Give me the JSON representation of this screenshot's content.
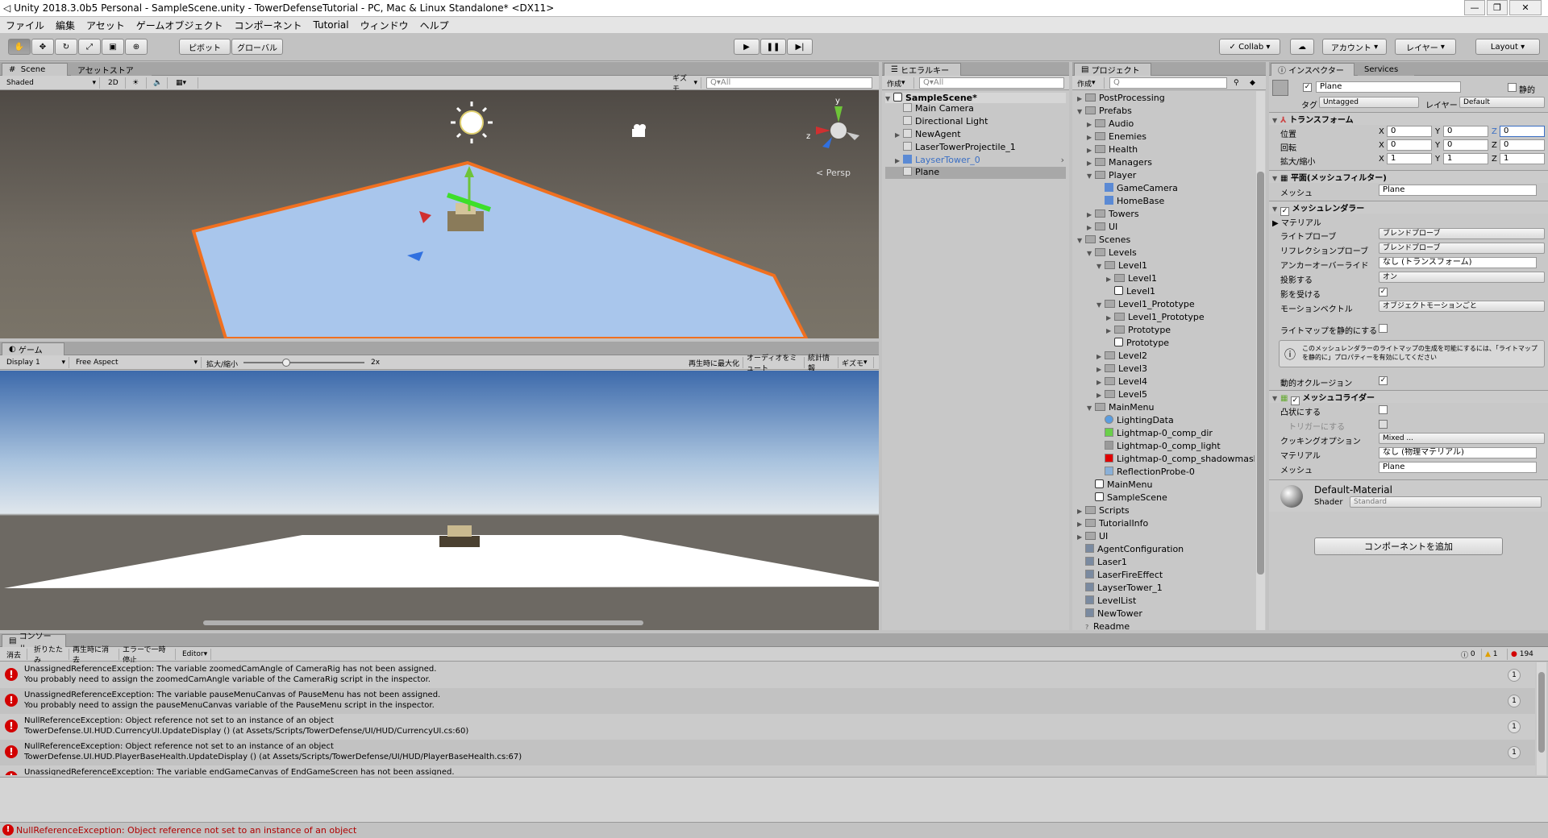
{
  "window": {
    "title": "Unity 2018.3.0b5 Personal - SampleScene.unity - TowerDefenseTutorial - PC, Mac & Linux Standalone* <DX11>"
  },
  "menu": [
    "ファイル",
    "編集",
    "アセット",
    "ゲームオブジェクト",
    "コンポーネント",
    "Tutorial",
    "ウィンドウ",
    "ヘルプ"
  ],
  "toolbar": {
    "pivot": "ピボット",
    "global": "グローバル",
    "collab": "Collab",
    "account": "アカウント",
    "layers": "レイヤー",
    "layout": "Layout"
  },
  "scene": {
    "tab": "Scene",
    "tab2": "アセットストア",
    "shading": "Shaded",
    "mode2d": "2D",
    "gizmos": "ギズモ",
    "search": "Q▾All",
    "persp": "< Persp"
  },
  "game": {
    "tab": "ゲーム",
    "display": "Display 1",
    "aspect": "Free Aspect",
    "scale_label": "拡大/縮小",
    "scale_value": "2x",
    "maximize": "再生時に最大化",
    "mute": "オーディオをミュート",
    "stats": "統計情報",
    "gizmos": "ギズモ",
    "scale_level": 0.35
  },
  "hierarchy": {
    "tab": "ヒエラルキー",
    "create": "作成",
    "search": "Q▾All",
    "scene": "SampleScene*",
    "items": [
      "Main Camera",
      "Directional Light",
      "NewAgent",
      "LaserTowerProjectile_1",
      "LayserTower_0",
      "Plane"
    ]
  },
  "project": {
    "tab": "プロジェクト",
    "create": "作成",
    "items": [
      {
        "label": "PostProcessing",
        "d": 0,
        "t": "folder",
        "f": "▶"
      },
      {
        "label": "Prefabs",
        "d": 0,
        "t": "folder",
        "f": "▼"
      },
      {
        "label": "Audio",
        "d": 1,
        "t": "folder",
        "f": "▶"
      },
      {
        "label": "Enemies",
        "d": 1,
        "t": "folder",
        "f": "▶"
      },
      {
        "label": "Health",
        "d": 1,
        "t": "folder",
        "f": "▶"
      },
      {
        "label": "Managers",
        "d": 1,
        "t": "folder",
        "f": "▶"
      },
      {
        "label": "Player",
        "d": 1,
        "t": "folder",
        "f": "▼"
      },
      {
        "label": "GameCamera",
        "d": 2,
        "t": "cube",
        "f": ""
      },
      {
        "label": "HomeBase",
        "d": 2,
        "t": "cube",
        "f": ""
      },
      {
        "label": "Towers",
        "d": 1,
        "t": "folder",
        "f": "▶"
      },
      {
        "label": "UI",
        "d": 1,
        "t": "folder",
        "f": "▶"
      },
      {
        "label": "Scenes",
        "d": 0,
        "t": "folder",
        "f": "▼"
      },
      {
        "label": "Levels",
        "d": 1,
        "t": "folder",
        "f": "▼"
      },
      {
        "label": "Level1",
        "d": 2,
        "t": "folder",
        "f": "▼"
      },
      {
        "label": "Level1",
        "d": 3,
        "t": "folder",
        "f": "▶"
      },
      {
        "label": "Level1",
        "d": 3,
        "t": "scene",
        "f": ""
      },
      {
        "label": "Level1_Prototype",
        "d": 2,
        "t": "folder",
        "f": "▼"
      },
      {
        "label": "Level1_Prototype",
        "d": 3,
        "t": "folder",
        "f": "▶"
      },
      {
        "label": "Prototype",
        "d": 3,
        "t": "folder",
        "f": "▶"
      },
      {
        "label": "Prototype",
        "d": 3,
        "t": "scene",
        "f": ""
      },
      {
        "label": "Level2",
        "d": 2,
        "t": "folder",
        "f": "▶"
      },
      {
        "label": "Level3",
        "d": 2,
        "t": "folder",
        "f": "▶"
      },
      {
        "label": "Level4",
        "d": 2,
        "t": "folder",
        "f": "▶"
      },
      {
        "label": "Level5",
        "d": 2,
        "t": "folder",
        "f": "▶"
      },
      {
        "label": "MainMenu",
        "d": 1,
        "t": "folder",
        "f": "▼"
      },
      {
        "label": "LightingData",
        "d": 2,
        "t": "light",
        "f": ""
      },
      {
        "label": "Lightmap-0_comp_dir",
        "d": 2,
        "t": "green",
        "f": ""
      },
      {
        "label": "Lightmap-0_comp_light",
        "d": 2,
        "t": "gray",
        "f": ""
      },
      {
        "label": "Lightmap-0_comp_shadowmask",
        "d": 2,
        "t": "red",
        "f": ""
      },
      {
        "label": "ReflectionProbe-0",
        "d": 2,
        "t": "probe",
        "f": ""
      },
      {
        "label": "MainMenu",
        "d": 1,
        "t": "scene",
        "f": ""
      },
      {
        "label": "SampleScene",
        "d": 1,
        "t": "scene",
        "f": ""
      },
      {
        "label": "Scripts",
        "d": 0,
        "t": "folder",
        "f": "▶"
      },
      {
        "label": "TutorialInfo",
        "d": 0,
        "t": "folder",
        "f": "▶"
      },
      {
        "label": "UI",
        "d": 0,
        "t": "folder",
        "f": "▶"
      },
      {
        "label": "AgentConfiguration",
        "d": 0,
        "t": "asset",
        "f": ""
      },
      {
        "label": "Laser1",
        "d": 0,
        "t": "asset",
        "f": ""
      },
      {
        "label": "LaserFireEffect",
        "d": 0,
        "t": "asset",
        "f": ""
      },
      {
        "label": "LayserTower_1",
        "d": 0,
        "t": "asset",
        "f": ""
      },
      {
        "label": "LevelList",
        "d": 0,
        "t": "asset",
        "f": ""
      },
      {
        "label": "NewTower",
        "d": 0,
        "t": "asset",
        "f": ""
      },
      {
        "label": "Readme",
        "d": 0,
        "t": "readme",
        "f": ""
      }
    ]
  },
  "inspector": {
    "tab": "インスペクター",
    "tab2": "Services",
    "name": "Plane",
    "static": "静的",
    "tag_label": "タグ",
    "tag": "Untagged",
    "layer_label": "レイヤー",
    "layer": "Default",
    "transform": {
      "title": "トランスフォーム",
      "position": "位置",
      "rotation": "回転",
      "scale": "拡大/縮小",
      "pos": [
        "0",
        "0",
        "0"
      ],
      "rot": [
        "0",
        "0",
        "0"
      ],
      "scl": [
        "1",
        "1",
        "1"
      ]
    },
    "meshfilter": {
      "title": "平面(メッシュフィルター)",
      "mesh_label": "メッシュ",
      "mesh": "Plane"
    },
    "renderer": {
      "title": "メッシュレンダラー",
      "materials": "マテリアル",
      "light_probes": "ライトプローブ",
      "light_probes_v": "ブレンドプローブ",
      "refl_probes": "リフレクションプローブ",
      "refl_probes_v": "ブレンドプローブ",
      "anchor": "アンカーオーバーライド",
      "anchor_v": "なし (トランスフォーム)",
      "cast": "投影する",
      "cast_v": "オン",
      "receive": "影を受ける",
      "motion": "モーションベクトル",
      "motion_v": "オブジェクトモーションごと",
      "static_lm": "ライトマップを静的にする",
      "info": "このメッシュレンダラーのライトマップの生成を可能にするには、「ライトマップを静的に」プロパティーを有効にしてください",
      "dyn_occ": "動的オクルージョン"
    },
    "collider": {
      "title": "メッシュコライダー",
      "convex": "凸状にする",
      "trigger": "トリガーにする",
      "cooking": "クッキングオプション",
      "cooking_v": "Mixed ...",
      "material": "マテリアル",
      "material_v": "なし (物理マテリアル)",
      "mesh": "メッシュ",
      "mesh_v": "Plane"
    },
    "material": {
      "name": "Default-Material",
      "shader_label": "Shader",
      "shader": "Standard"
    },
    "add_component": "コンポーネントを追加"
  },
  "console": {
    "tab": "コンソール",
    "clear": "消去",
    "collapse": "折りたたみ",
    "clear_on_play": "再生時に消去",
    "error_pause": "エラーで一時停止",
    "editor": "Editor",
    "count_info": "0",
    "count_warn": "1",
    "count_err": "194",
    "entries": [
      {
        "l1": "UnassignedReferenceException: The variable zoomedCamAngle of CameraRig has not been assigned.",
        "l2": "You probably need to assign the zoomedCamAngle variable of the CameraRig script in the inspector.",
        "n": "1"
      },
      {
        "l1": "UnassignedReferenceException: The variable pauseMenuCanvas of PauseMenu has not been assigned.",
        "l2": "You probably need to assign the pauseMenuCanvas variable of the PauseMenu script in the inspector.",
        "n": "1"
      },
      {
        "l1": "NullReferenceException: Object reference not set to an instance of an object",
        "l2": "TowerDefense.UI.HUD.CurrencyUI.UpdateDisplay () (at Assets/Scripts/TowerDefense/UI/HUD/CurrencyUI.cs:60)",
        "n": "1"
      },
      {
        "l1": "NullReferenceException: Object reference not set to an instance of an object",
        "l2": "TowerDefense.UI.HUD.PlayerBaseHealth.UpdateDisplay () (at Assets/Scripts/TowerDefense/UI/HUD/PlayerBaseHealth.cs:67)",
        "n": "1"
      },
      {
        "l1": "UnassignedReferenceException: The variable endGameCanvas of EndGameScreen has not been assigned.",
        "l2": "",
        "n": ""
      }
    ]
  },
  "statusbar": {
    "message": "NullReferenceException: Object reference not set to an instance of an object"
  },
  "colors": {
    "accent": "#3b6fc4",
    "error": "#d20000",
    "plane_edge": "#f07020"
  }
}
